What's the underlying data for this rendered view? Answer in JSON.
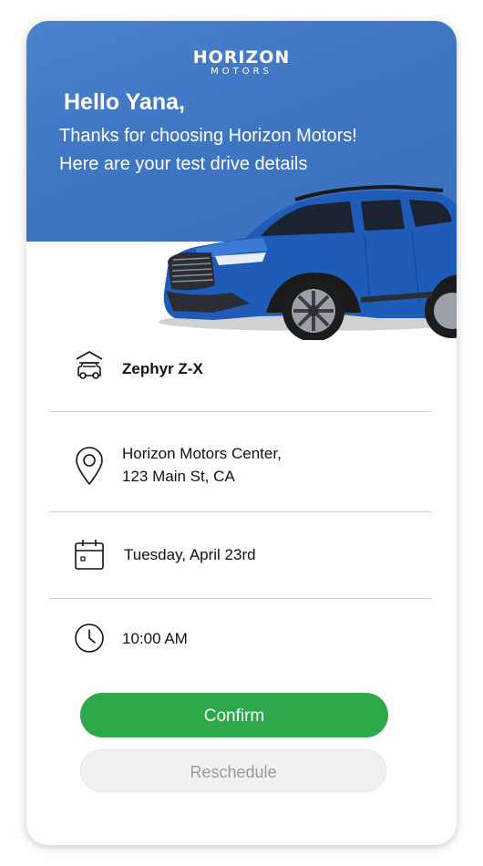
{
  "brand": {
    "logo_top": "HORIZON",
    "logo_bottom": "MOTORS",
    "accent": "#3f76c4"
  },
  "greeting": {
    "title": "Hello Yana,",
    "line1": "Thanks for choosing Horizon Motors!",
    "line2": "Here are your test drive details"
  },
  "details": {
    "vehicle": "Zephyr Z-X",
    "location_line1": "Horizon Motors Center,",
    "location_line2": "123 Main St, CA",
    "date": "Tuesday, April 23rd",
    "time": "10:00 AM"
  },
  "actions": {
    "confirm_label": "Confirm",
    "confirm_color": "#2da84b",
    "reschedule_label": "Reschedule"
  },
  "icons": {
    "vehicle": "car-garage-icon",
    "location": "map-pin-icon",
    "date": "calendar-icon",
    "time": "clock-icon"
  }
}
